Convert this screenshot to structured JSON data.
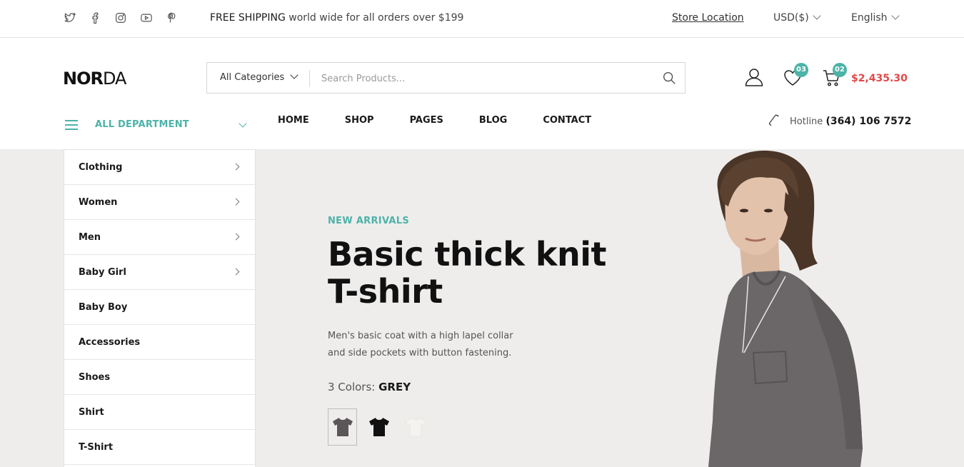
{
  "topbar": {
    "social_icons": [
      "twitter-icon",
      "facebook-icon",
      "instagram-icon",
      "youtube-icon",
      "pinterest-icon"
    ],
    "shipping_bold": "FREE SHIPPING",
    "shipping_rest": " world wide for all orders over $199",
    "store_location": "Store Location",
    "currency": "USD($)",
    "language": "English"
  },
  "header": {
    "logo_bold": "NOR",
    "logo_thin": "DA",
    "search": {
      "category": "All Categories",
      "placeholder": "Search Products..."
    },
    "wishlist_count": "03",
    "cart_count": "02",
    "cart_total": "$2,435.30"
  },
  "nav": {
    "department_label": "ALL DEPARTMENT",
    "items": [
      "HOME",
      "SHOP",
      "PAGES",
      "BLOG",
      "CONTACT"
    ],
    "hotline_label": "Hotline",
    "hotline_number": "(364) 106 7572"
  },
  "sidebar": {
    "items": [
      {
        "label": "Clothing",
        "has_submenu": true
      },
      {
        "label": "Women",
        "has_submenu": true
      },
      {
        "label": "Men",
        "has_submenu": true
      },
      {
        "label": "Baby Girl",
        "has_submenu": true
      },
      {
        "label": "Baby Boy",
        "has_submenu": false
      },
      {
        "label": "Accessories",
        "has_submenu": false
      },
      {
        "label": "Shoes",
        "has_submenu": false
      },
      {
        "label": "Shirt",
        "has_submenu": false
      },
      {
        "label": "T-Shirt",
        "has_submenu": false
      }
    ]
  },
  "hero": {
    "tagline": "NEW ARRIVALS",
    "title_line1": "Basic thick knit",
    "title_line2": "T-shirt",
    "desc_line1": "Men's basic coat with a high lapel collar",
    "desc_line2": "and side pockets with button fastening.",
    "colors_label": "3 Colors: ",
    "selected_color": "GREY",
    "swatches": [
      {
        "name": "grey",
        "color": "#5b5657"
      },
      {
        "name": "black",
        "color": "#111111"
      },
      {
        "name": "white",
        "color": "#f5f3ef"
      }
    ]
  },
  "colors": {
    "accent": "#4db3a8",
    "price": "#e04a4a",
    "hero_bg": "#eeedec"
  }
}
